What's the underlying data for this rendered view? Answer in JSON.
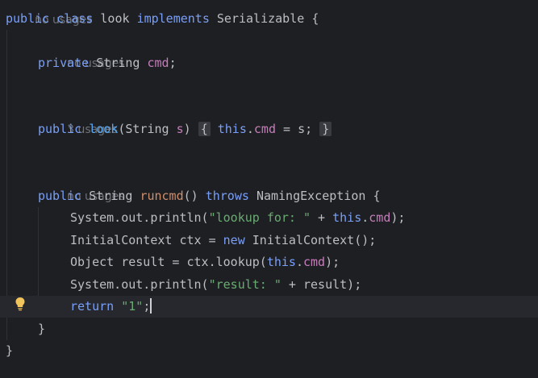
{
  "editor": {
    "top_hint": "no usages",
    "lines": {
      "class_decl": {
        "kw_public": "public",
        "kw_class": "class",
        "name": "look",
        "kw_implements": "implements",
        "iface": "Serializable",
        "brace": "{"
      },
      "hint_field": "no usages",
      "field_decl": {
        "kw_private": "private",
        "type": "String",
        "name": "cmd",
        "semi": ";"
      },
      "hint_ctor": "3 usages",
      "ctor_decl": {
        "kw_public": "public",
        "name": "look",
        "params_open": "(String ",
        "param": "s",
        "params_close": ")",
        "fold_open": "{",
        "kw_this": "this",
        "dot": ".",
        "field": "cmd",
        "assign": " = s;",
        "fold_close": "}"
      },
      "hint_method": "no usages",
      "method_decl": {
        "kw_public": "public",
        "type": "String",
        "name": "runcmd",
        "parens": "()",
        "kw_throws": "throws",
        "exc": "NamingException",
        "brace": "{"
      },
      "stmt1": {
        "prefix": "System.out.println(",
        "str": "\"lookup for: \"",
        "plus": " + ",
        "kw_this": "this",
        "dot": ".",
        "field": "cmd",
        "suffix": ");"
      },
      "stmt2": {
        "prefix": "InitialContext ctx = ",
        "kw_new": "new",
        "suffix": " InitialContext();"
      },
      "stmt3": {
        "prefix": "Object result = ctx.lookup(",
        "kw_this": "this",
        "dot": ".",
        "field": "cmd",
        "suffix": ");"
      },
      "stmt4": {
        "prefix": "System.out.println(",
        "str": "\"result: \"",
        "suffix": " + result);"
      },
      "stmt5": {
        "kw_return": "return",
        "str": "\"1\"",
        "semi": ";"
      },
      "close_method": "}",
      "close_class": "}"
    },
    "gutter_icon": "lightbulb-icon"
  }
}
